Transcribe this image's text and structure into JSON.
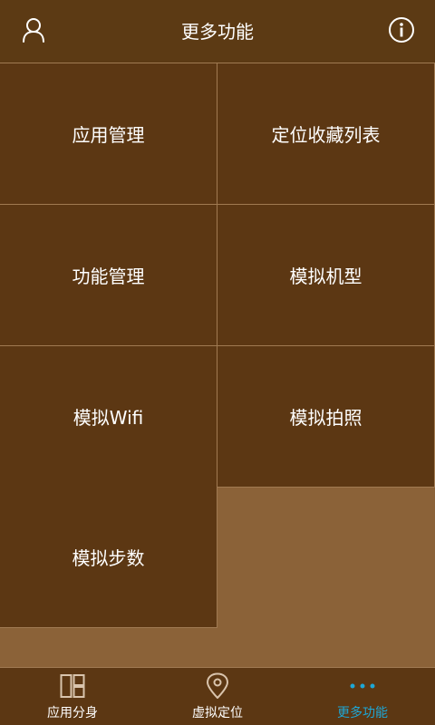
{
  "header": {
    "title": "更多功能",
    "left_icon": "user-icon",
    "right_icon": "info-icon"
  },
  "features": [
    {
      "label": "应用管理"
    },
    {
      "label": "定位收藏列表"
    },
    {
      "label": "功能管理"
    },
    {
      "label": "模拟机型"
    },
    {
      "label": "模拟Wifi"
    },
    {
      "label": "模拟拍照"
    },
    {
      "label": "模拟步数"
    }
  ],
  "tabs": [
    {
      "label": "应用分身",
      "icon": "layout-icon",
      "active": false
    },
    {
      "label": "虚拟定位",
      "icon": "location-pin-icon",
      "active": false
    },
    {
      "label": "更多功能",
      "icon": "more-dots-icon",
      "active": true
    }
  ],
  "colors": {
    "background": "#8b6238",
    "tile": "#5c3713",
    "divider": "#a07a52",
    "active_tab": "#1ea7d6",
    "text": "#ffffff"
  }
}
